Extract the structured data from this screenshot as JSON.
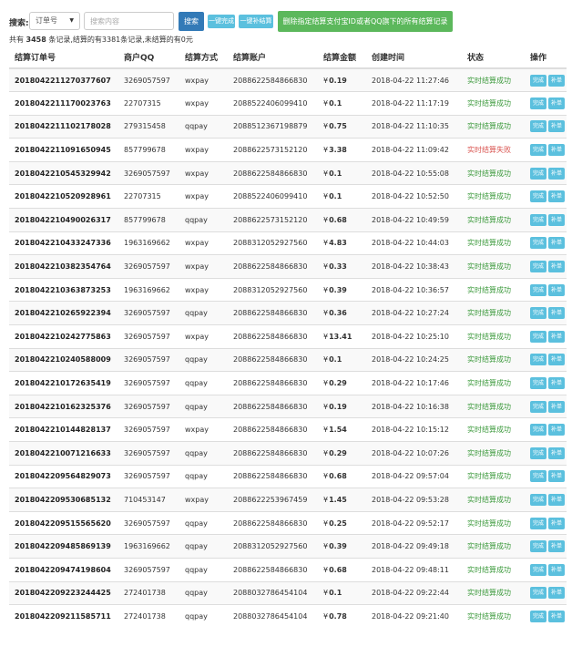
{
  "toolbar": {
    "label": "搜索:",
    "select_value": "订单号",
    "search_placeholder": "搜索内容",
    "search_button": "搜索",
    "finish_all_button": "一键完成",
    "resend_all_button": "一键补结算",
    "delete_button": "删除指定结算支付宝ID或者QQ旗下的所有结算记录"
  },
  "summary": {
    "prefix": "共有",
    "total": "3458",
    "middle": "条记录,结算的有3381条记录,未结算的有0元"
  },
  "table": {
    "headers": [
      "结算订单号",
      "商户QQ",
      "结算方式",
      "结算账户",
      "结算金额",
      "创建时间",
      "状态",
      "操作"
    ],
    "currency_symbol": "¥",
    "op_finish": "完成",
    "op_resend": "补单",
    "rows": [
      {
        "order": "2018042211270377607",
        "qq": "3269057597",
        "method": "wxpay",
        "account": "2088622584866830",
        "amount": "0.19",
        "time": "2018-04-22 11:27:46",
        "status": "实时结算成功",
        "ok": true
      },
      {
        "order": "2018042211170023763",
        "qq": "22707315",
        "method": "wxpay",
        "account": "2088522406099410",
        "amount": "0.1",
        "time": "2018-04-22 11:17:19",
        "status": "实时结算成功",
        "ok": true
      },
      {
        "order": "2018042211102178028",
        "qq": "279315458",
        "method": "qqpay",
        "account": "2088512367198879",
        "amount": "0.75",
        "time": "2018-04-22 11:10:35",
        "status": "实时结算成功",
        "ok": true
      },
      {
        "order": "2018042211091650945",
        "qq": "857799678",
        "method": "wxpay",
        "account": "2088622573152120",
        "amount": "3.38",
        "time": "2018-04-22 11:09:42",
        "status": "实时结算失败",
        "ok": false
      },
      {
        "order": "2018042210545329942",
        "qq": "3269057597",
        "method": "wxpay",
        "account": "2088622584866830",
        "amount": "0.1",
        "time": "2018-04-22 10:55:08",
        "status": "实时结算成功",
        "ok": true
      },
      {
        "order": "2018042210520928961",
        "qq": "22707315",
        "method": "wxpay",
        "account": "2088522406099410",
        "amount": "0.1",
        "time": "2018-04-22 10:52:50",
        "status": "实时结算成功",
        "ok": true
      },
      {
        "order": "2018042210490026317",
        "qq": "857799678",
        "method": "qqpay",
        "account": "2088622573152120",
        "amount": "0.68",
        "time": "2018-04-22 10:49:59",
        "status": "实时结算成功",
        "ok": true
      },
      {
        "order": "2018042210433247336",
        "qq": "1963169662",
        "method": "wxpay",
        "account": "2088312052927560",
        "amount": "4.83",
        "time": "2018-04-22 10:44:03",
        "status": "实时结算成功",
        "ok": true
      },
      {
        "order": "2018042210382354764",
        "qq": "3269057597",
        "method": "wxpay",
        "account": "2088622584866830",
        "amount": "0.33",
        "time": "2018-04-22 10:38:43",
        "status": "实时结算成功",
        "ok": true
      },
      {
        "order": "2018042210363873253",
        "qq": "1963169662",
        "method": "wxpay",
        "account": "2088312052927560",
        "amount": "0.39",
        "time": "2018-04-22 10:36:57",
        "status": "实时结算成功",
        "ok": true
      },
      {
        "order": "2018042210265922394",
        "qq": "3269057597",
        "method": "qqpay",
        "account": "2088622584866830",
        "amount": "0.36",
        "time": "2018-04-22 10:27:24",
        "status": "实时结算成功",
        "ok": true
      },
      {
        "order": "2018042210242775863",
        "qq": "3269057597",
        "method": "wxpay",
        "account": "2088622584866830",
        "amount": "13.41",
        "time": "2018-04-22 10:25:10",
        "status": "实时结算成功",
        "ok": true
      },
      {
        "order": "2018042210240588009",
        "qq": "3269057597",
        "method": "qqpay",
        "account": "2088622584866830",
        "amount": "0.1",
        "time": "2018-04-22 10:24:25",
        "status": "实时结算成功",
        "ok": true
      },
      {
        "order": "2018042210172635419",
        "qq": "3269057597",
        "method": "qqpay",
        "account": "2088622584866830",
        "amount": "0.29",
        "time": "2018-04-22 10:17:46",
        "status": "实时结算成功",
        "ok": true
      },
      {
        "order": "2018042210162325376",
        "qq": "3269057597",
        "method": "qqpay",
        "account": "2088622584866830",
        "amount": "0.19",
        "time": "2018-04-22 10:16:38",
        "status": "实时结算成功",
        "ok": true
      },
      {
        "order": "2018042210144828137",
        "qq": "3269057597",
        "method": "wxpay",
        "account": "2088622584866830",
        "amount": "1.54",
        "time": "2018-04-22 10:15:12",
        "status": "实时结算成功",
        "ok": true
      },
      {
        "order": "2018042210071216633",
        "qq": "3269057597",
        "method": "qqpay",
        "account": "2088622584866830",
        "amount": "0.29",
        "time": "2018-04-22 10:07:26",
        "status": "实时结算成功",
        "ok": true
      },
      {
        "order": "2018042209564829073",
        "qq": "3269057597",
        "method": "qqpay",
        "account": "2088622584866830",
        "amount": "0.68",
        "time": "2018-04-22 09:57:04",
        "status": "实时结算成功",
        "ok": true
      },
      {
        "order": "2018042209530685132",
        "qq": "710453147",
        "method": "wxpay",
        "account": "2088622253967459",
        "amount": "1.45",
        "time": "2018-04-22 09:53:28",
        "status": "实时结算成功",
        "ok": true
      },
      {
        "order": "2018042209515565620",
        "qq": "3269057597",
        "method": "qqpay",
        "account": "2088622584866830",
        "amount": "0.25",
        "time": "2018-04-22 09:52:17",
        "status": "实时结算成功",
        "ok": true
      },
      {
        "order": "2018042209485869139",
        "qq": "1963169662",
        "method": "qqpay",
        "account": "2088312052927560",
        "amount": "0.39",
        "time": "2018-04-22 09:49:18",
        "status": "实时结算成功",
        "ok": true
      },
      {
        "order": "2018042209474198604",
        "qq": "3269057597",
        "method": "qqpay",
        "account": "2088622584866830",
        "amount": "0.68",
        "time": "2018-04-22 09:48:11",
        "status": "实时结算成功",
        "ok": true
      },
      {
        "order": "2018042209223244425",
        "qq": "272401738",
        "method": "qqpay",
        "account": "2088032786454104",
        "amount": "0.1",
        "time": "2018-04-22 09:22:44",
        "status": "实时结算成功",
        "ok": true
      },
      {
        "order": "2018042209211585711",
        "qq": "272401738",
        "method": "qqpay",
        "account": "2088032786454104",
        "amount": "0.78",
        "time": "2018-04-22 09:21:40",
        "status": "实时结算成功",
        "ok": true
      }
    ]
  },
  "colors": {
    "primary": "#337ab7",
    "info": "#5bc0de",
    "success_button": "#5cb85c",
    "status_ok": "#3c9a3c",
    "status_fail": "#d9534f"
  }
}
